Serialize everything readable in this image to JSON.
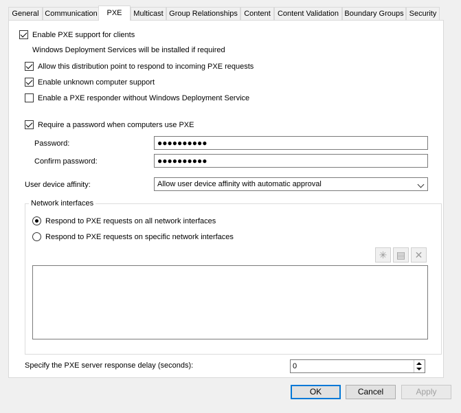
{
  "tabs": [
    {
      "label": "General"
    },
    {
      "label": "Communication"
    },
    {
      "label": "PXE"
    },
    {
      "label": "Multicast"
    },
    {
      "label": "Group Relationships"
    },
    {
      "label": "Content"
    },
    {
      "label": "Content Validation"
    },
    {
      "label": "Boundary Groups"
    },
    {
      "label": "Security"
    }
  ],
  "active_tab": "PXE",
  "pxe": {
    "enable_label": "Enable PXE support for clients",
    "enable_checked": true,
    "wds_note": "Windows Deployment Services will be installed if required",
    "allow_label": "Allow this distribution point to respond to incoming PXE requests",
    "allow_checked": true,
    "unknown_label": "Enable unknown computer support",
    "unknown_checked": true,
    "responder_label": "Enable a PXE responder without Windows Deployment Service",
    "responder_checked": false,
    "require_pw_label": "Require a password when computers use PXE",
    "require_pw_checked": true,
    "password_label": "Password:",
    "password_value": "●●●●●●●●●●",
    "confirm_label": "Confirm password:",
    "confirm_value": "●●●●●●●●●●",
    "affinity_label": "User device affinity:",
    "affinity_value": "Allow user device affinity with automatic approval"
  },
  "network": {
    "group_title": "Network interfaces",
    "all_label": "Respond to PXE requests on all network interfaces",
    "all_selected": true,
    "specific_label": "Respond to PXE requests on specific network interfaces",
    "specific_selected": false,
    "toolbar_icons": [
      "new-icon",
      "properties-icon",
      "delete-icon"
    ]
  },
  "delay": {
    "label": "Specify the PXE server response delay (seconds):",
    "value": "0"
  },
  "buttons": {
    "ok": "OK",
    "cancel": "Cancel",
    "apply": "Apply"
  }
}
